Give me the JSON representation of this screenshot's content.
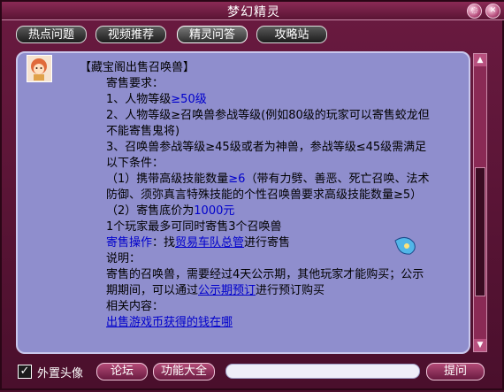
{
  "window": {
    "title": "梦幻精灵"
  },
  "tabs": [
    {
      "label": "热点问题",
      "active": false
    },
    {
      "label": "视频推荐",
      "active": false
    },
    {
      "label": "精灵问答",
      "active": true
    },
    {
      "label": "攻略站",
      "active": false
    }
  ],
  "answer": {
    "heading": "【藏宝阁出售召唤兽】",
    "req_title": "寄售要求：",
    "req1_prefix": "1、人物等级",
    "req1_value": "≥50级",
    "req2": "2、人物等级≥召唤兽参战等级(例如80级的玩家可以寄售蛟龙但不能寄售鬼将)",
    "req3": "3、召唤兽参战等级≥45级或者为神兽，参战等级≤45级需满足以下条件：",
    "cond1_prefix": "（1）携带高级技能数量",
    "cond1_value": "≥6",
    "cond1_suffix": "（带有力劈、善恶、死亡召唤、法术防御、须弥真言特殊技能的个性召唤兽要求高级技能数量≥5）",
    "cond2_prefix": "（2）寄售底价为",
    "cond2_value": "1000元",
    "limit": "1个玩家最多可同时寄售3个召唤兽",
    "op_label": "寄售操作",
    "op_text1": "：找",
    "op_link": "贸易车队总管",
    "op_text2": "进行寄售",
    "note_title": "说明：",
    "note1": "寄售的召唤兽，需要经过4天公示期，其他玩家才能购买；公示期期间，可以通过",
    "note1_link": "公示期预订",
    "note1_suffix": "进行预订购买",
    "related_title": "相关内容：",
    "related_link": "出售游戏币获得的钱在哪"
  },
  "bottom": {
    "checkbox_label": "外置头像",
    "checkbox_checked": true,
    "forum_button": "论坛",
    "functions_button": "功能大全",
    "ask_button": "提问",
    "input_value": ""
  }
}
